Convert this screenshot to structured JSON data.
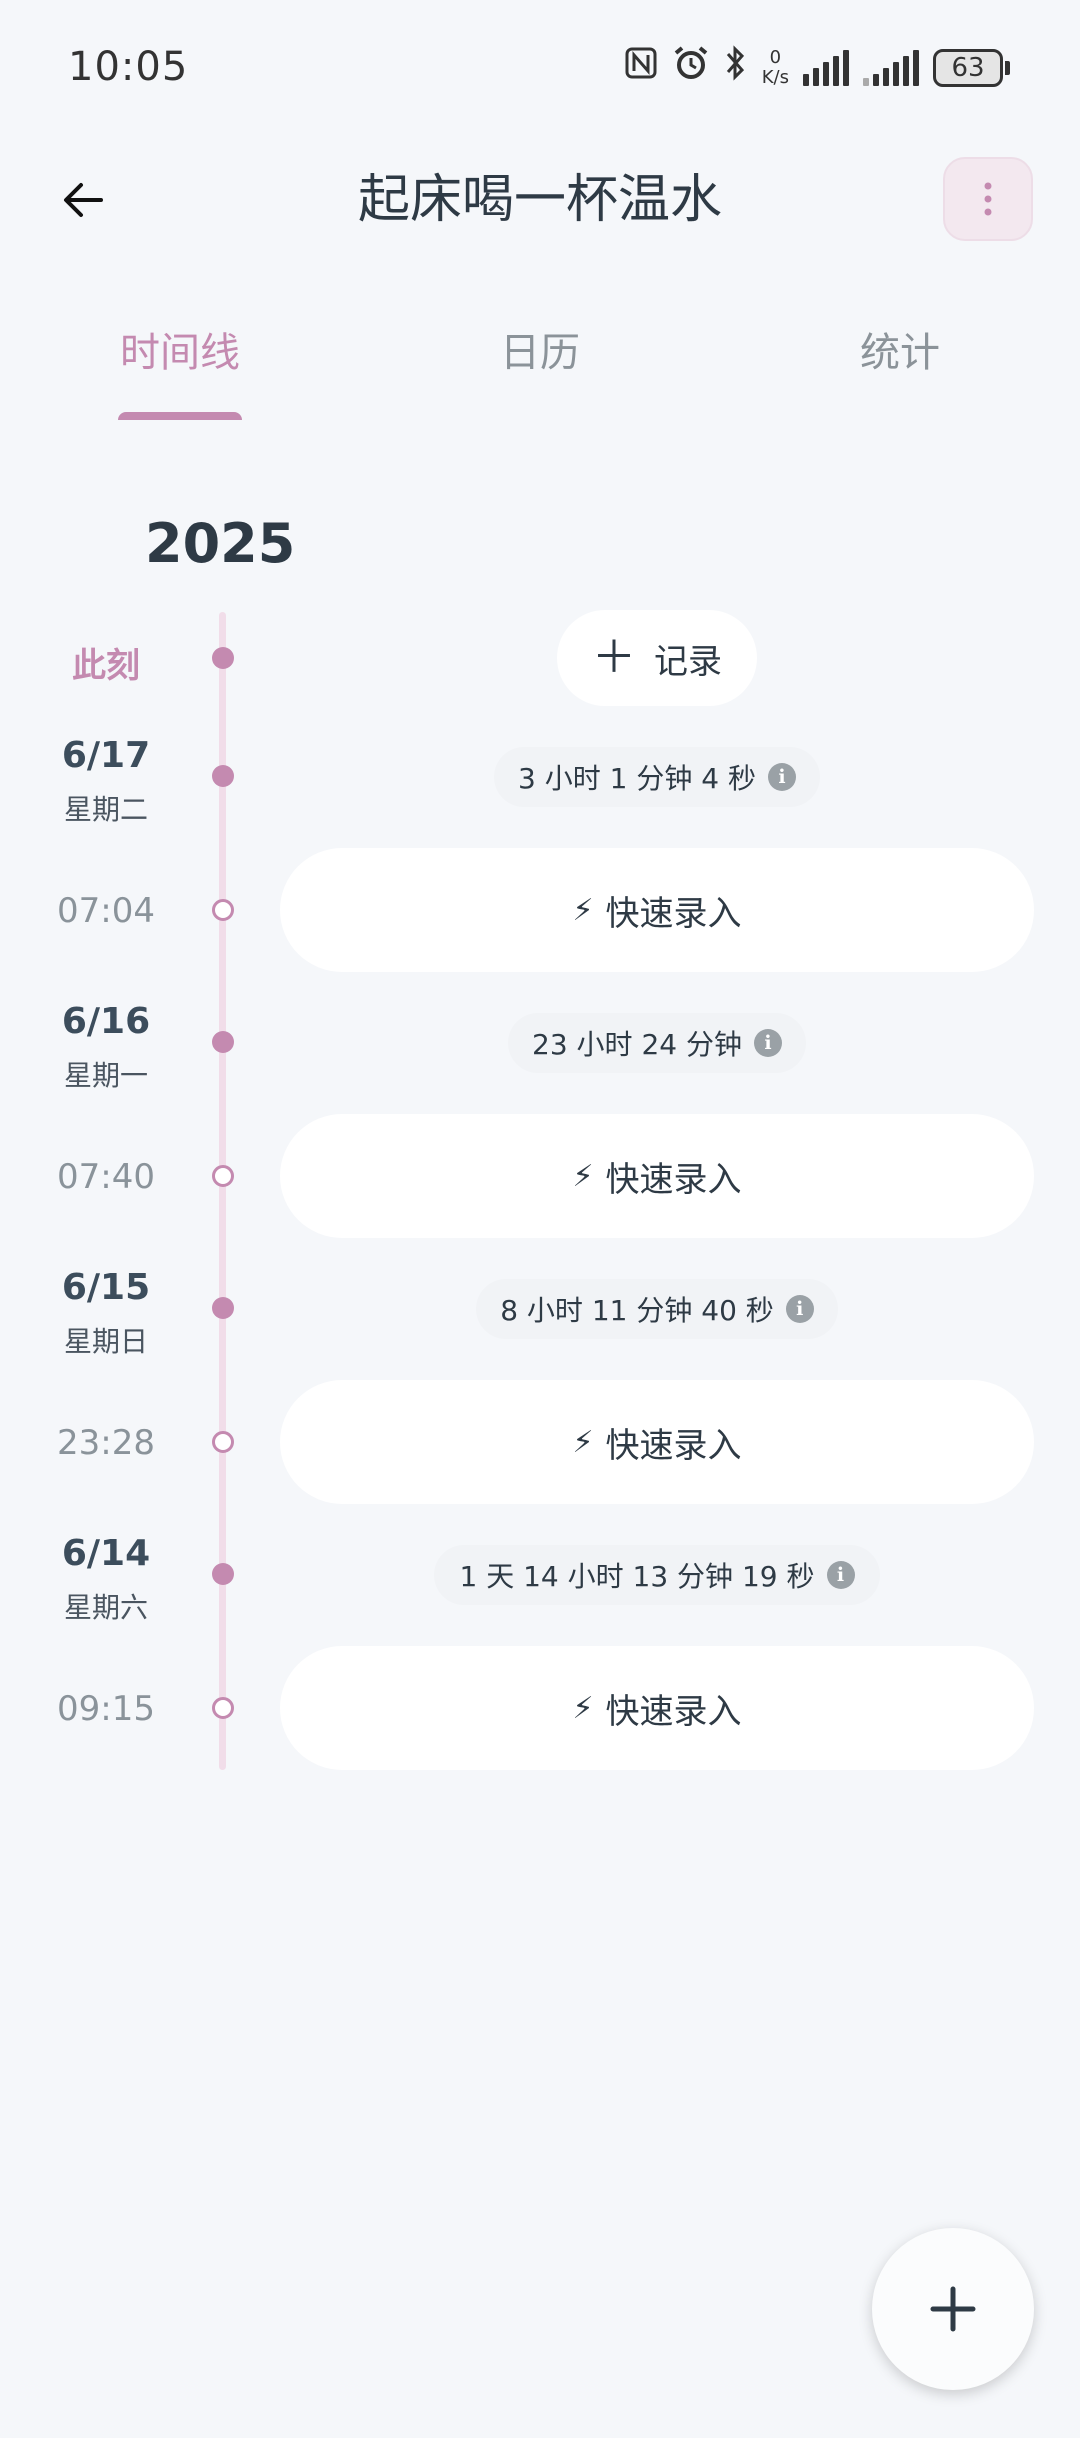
{
  "status_bar": {
    "time": "10:05",
    "net_speed_value": "0",
    "net_speed_unit": "K/s",
    "battery": "63",
    "icons": [
      "nfc-icon",
      "alarm-icon",
      "bluetooth-icon",
      "signal-icon",
      "signal-icon",
      "battery-icon"
    ]
  },
  "appbar": {
    "title": "起床喝一杯温水",
    "icons": [
      "back-arrow-icon",
      "more-vertical-icon"
    ]
  },
  "tabs": [
    {
      "label": "时间线",
      "active": true
    },
    {
      "label": "日历",
      "active": false
    },
    {
      "label": "统计",
      "active": false
    }
  ],
  "timeline": {
    "year": "2025",
    "now_label": "此刻",
    "record_label": "记录",
    "quick_entry_label": "快速录入",
    "entries": [
      {
        "date": "6/17",
        "weekday": "星期二",
        "duration": "3 小时 1 分钟 4 秒",
        "time": "07:04"
      },
      {
        "date": "6/16",
        "weekday": "星期一",
        "duration": "23 小时 24 分钟",
        "time": "07:40"
      },
      {
        "date": "6/15",
        "weekday": "星期日",
        "duration": "8 小时 11 分钟 40 秒",
        "time": "23:28"
      },
      {
        "date": "6/14",
        "weekday": "星期六",
        "duration": "1 天 14 小时 13 分钟 19 秒",
        "time": "09:15"
      }
    ]
  },
  "colors": {
    "accent": "#c48ab0",
    "background": "#f5f7fa",
    "text": "#2e3a45"
  }
}
